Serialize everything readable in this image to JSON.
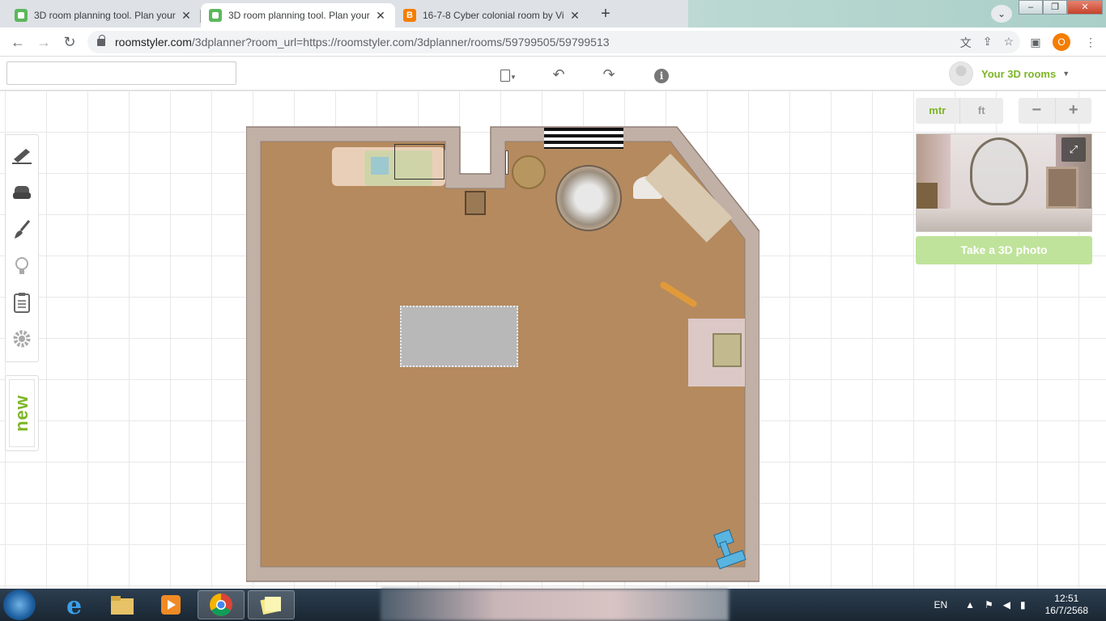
{
  "browser": {
    "tabs": [
      {
        "title": "3D room planning tool. Plan your",
        "favicon": "roomstyler-icon",
        "active": false
      },
      {
        "title": "3D room planning tool. Plan your",
        "favicon": "roomstyler-icon",
        "active": true
      },
      {
        "title": "16-7-8 Cyber colonial room by Vi",
        "favicon": "blogger-icon",
        "active": false
      }
    ],
    "close_glyph": "✕",
    "new_tab_glyph": "+",
    "url_host": "roomstyler.com",
    "url_path": "/3dplanner?room_url=https://roomstyler.com/3dplanner/rooms/59799505/59799513",
    "profile_initial": "O",
    "blogger_glyph": "B"
  },
  "app": {
    "search": {
      "placeholder": "",
      "value": ""
    },
    "account": {
      "label": "Your 3D rooms",
      "caret": "▼"
    },
    "units": {
      "metric": "mtr",
      "imperial": "ft",
      "selected": "mtr"
    },
    "zoom": {
      "out": "−",
      "in": "+"
    },
    "photo_button": "Take a 3D photo",
    "new_badge": "new",
    "colors": {
      "brand_green": "#7cb526",
      "photo_btn": "#bfe39a",
      "carpet": "#b58a5e",
      "wall": "#c1b0a6"
    }
  },
  "taskbar": {
    "language": "EN",
    "time": "12:51",
    "date": "16/7/2568"
  }
}
